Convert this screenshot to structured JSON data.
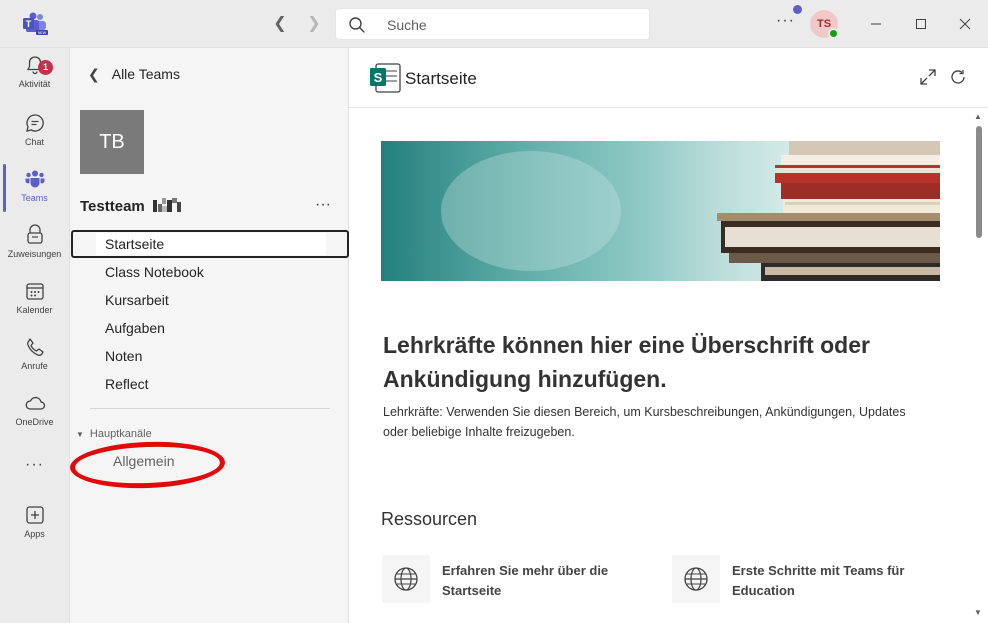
{
  "titlebar": {
    "search_placeholder": "Suche",
    "more_label": "···",
    "avatar_initials": "TS"
  },
  "rail": {
    "items": [
      {
        "label": "Aktivität",
        "icon": "bell-icon",
        "badge": "1"
      },
      {
        "label": "Chat",
        "icon": "chat-icon"
      },
      {
        "label": "Teams",
        "icon": "teams-icon"
      },
      {
        "label": "Zuweisungen",
        "icon": "assignments-icon"
      },
      {
        "label": "Kalender",
        "icon": "calendar-icon"
      },
      {
        "label": "Anrufe",
        "icon": "phone-icon"
      },
      {
        "label": "OneDrive",
        "icon": "cloud-icon"
      },
      {
        "label": "Apps",
        "icon": "add-app-icon"
      }
    ],
    "ellipsis": "···",
    "active_color": "#5b5fc7"
  },
  "sidebar": {
    "back_label": "Alle Teams",
    "team_initials": "TB",
    "team_name": "Testteam",
    "team_more": "···",
    "channels": [
      {
        "label": "Startseite",
        "selected": true
      },
      {
        "label": "Class Notebook"
      },
      {
        "label": "Kursarbeit"
      },
      {
        "label": "Aufgaben"
      },
      {
        "label": "Noten"
      },
      {
        "label": "Reflect"
      }
    ],
    "section_title": "Hauptkanäle",
    "channel_general": "Allgemein",
    "highlight_color": "#e3090b"
  },
  "content": {
    "tab_title": "Startseite",
    "headline": "Lehrkräfte können hier eine Überschrift oder Ankündigung hinzufügen.",
    "body": "Lehrkräfte: Verwenden Sie diesen Bereich, um Kursbeschreibungen, Ankündigungen, Updates oder beliebige Inhalte freizugeben.",
    "resources_title": "Ressourcen",
    "resources": [
      {
        "label": "Erfahren Sie mehr über die Startseite",
        "icon": "globe-icon"
      },
      {
        "label": "Erste Schritte mit Teams für Education",
        "icon": "globe-icon"
      }
    ]
  }
}
